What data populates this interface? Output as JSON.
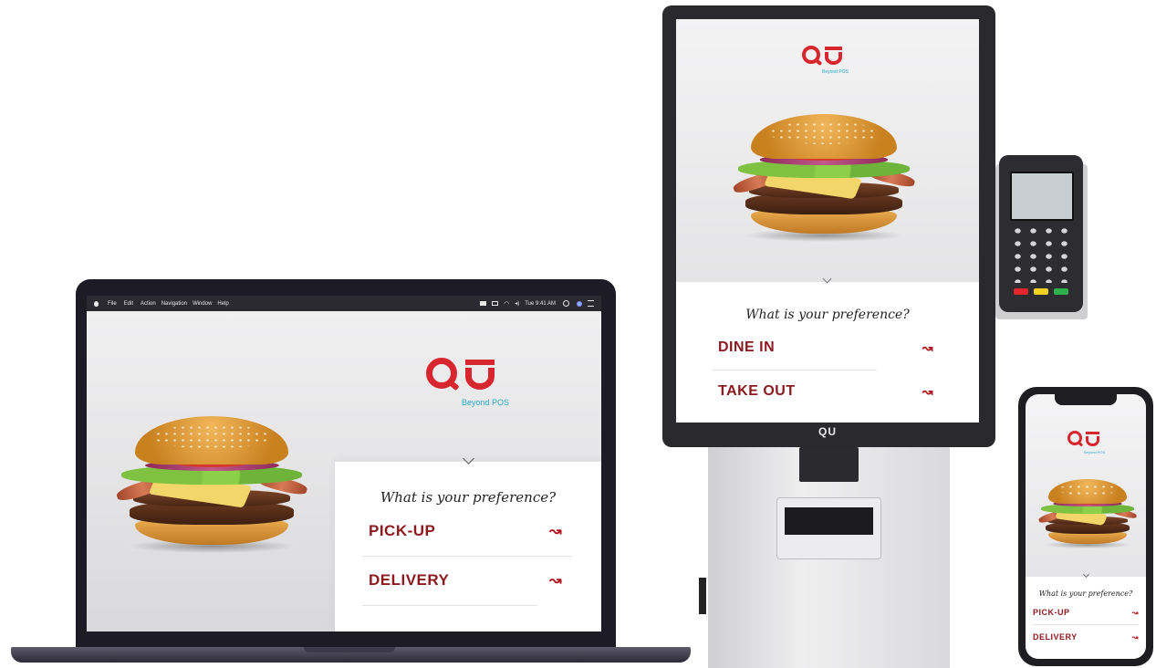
{
  "menubar": {
    "apple": "",
    "items": [
      "File",
      "Edit",
      "Action",
      "Navigation",
      "Window",
      "Help"
    ],
    "clock": "Tue 9:41 AM"
  },
  "brand": {
    "logo_letters": "QU",
    "tagline": "Beyond POS",
    "primary_color": "#d7262d",
    "accent_color": "#2aa7c9"
  },
  "laptop": {
    "question": "What is your preference?",
    "options": [
      {
        "label": "PICK-UP",
        "arrow": "↝"
      },
      {
        "label": "DELIVERY",
        "arrow": "↝"
      }
    ]
  },
  "kiosk": {
    "question": "What is your preference?",
    "options": [
      {
        "label": "DINE IN",
        "arrow": "↝"
      },
      {
        "label": "TAKE OUT",
        "arrow": "↝"
      }
    ],
    "bezel_logo": "QU"
  },
  "phone": {
    "question": "What is your preference?",
    "options": [
      {
        "label": "PICK-UP",
        "arrow": "↝"
      },
      {
        "label": "DELIVERY",
        "arrow": "↝"
      }
    ]
  },
  "icons": {
    "chevron": "chevron-down-icon",
    "arrow": "squiggle-arrow-icon"
  }
}
